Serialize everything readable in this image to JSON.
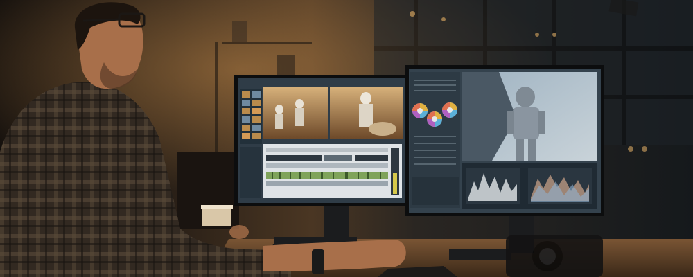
{
  "scene": {
    "description_free": true
  },
  "palette": {
    "room_dark": "#0f0c0a",
    "room_warm": "#3a2a1b",
    "window_glow": "#c38a4a",
    "desk_wood": "#6b4a2c",
    "monitor_bezel": "#111214",
    "ui_panel": "#3b4a57",
    "ui_panel_dark": "#22303a",
    "timeline_green": "#7fa35a",
    "timeline_white": "#e8e8e8",
    "sky_blue": "#6f8aa0",
    "astronaut_grey": "#9aa4ad",
    "desert_orange": "#b98b4c",
    "shirt_plaid": "#6d5a48",
    "skin": "#b07a55"
  },
  "icons": {
    "color_wheels": [
      "color-wheel-1",
      "color-wheel-2",
      "color-wheel-3"
    ]
  }
}
